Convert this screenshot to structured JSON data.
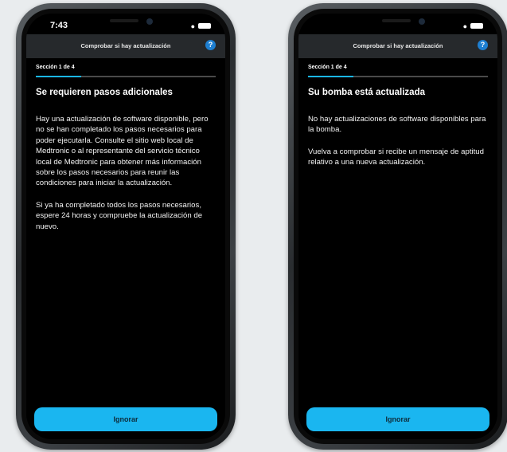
{
  "screens": [
    {
      "status_time": "7:43",
      "nav_title": "Comprobar si hay actualización",
      "help_label": "?",
      "section_label": "Sección 1 de 4",
      "progress": 0.25,
      "heading": "Se requieren pasos adicionales",
      "paragraphs": [
        "Hay una actualización de software disponible, pero no se han completado los pasos necesarios para poder ejecutarla. Consulte el sitio web local de Medtronic o al representante del servicio técnico local de Medtronic para obtener más información sobre los pasos necesarios para reunir las condiciones para iniciar la actualización.",
        "Si ya ha completado todos los pasos necesarios, espere 24 horas y compruebe la actualización de nuevo."
      ],
      "button_label": "Ignorar"
    },
    {
      "status_time": "",
      "nav_title": "Comprobar si hay actualización",
      "help_label": "?",
      "section_label": "Sección 1 de 4",
      "progress": 0.25,
      "heading": "Su bomba está actualizada",
      "paragraphs": [
        "No hay actualizaciones de software disponibles para la bomba.",
        "Vuelva a comprobar si recibe un mensaje de aptitud relativo a una nueva actualización."
      ],
      "button_label": "Ignorar"
    }
  ],
  "colors": {
    "accent": "#1ab6f0",
    "help_icon": "#1e7fd1",
    "screen_bg": "#000000",
    "navbar_bg": "#26292c",
    "page_bg": "#e9ecee"
  }
}
